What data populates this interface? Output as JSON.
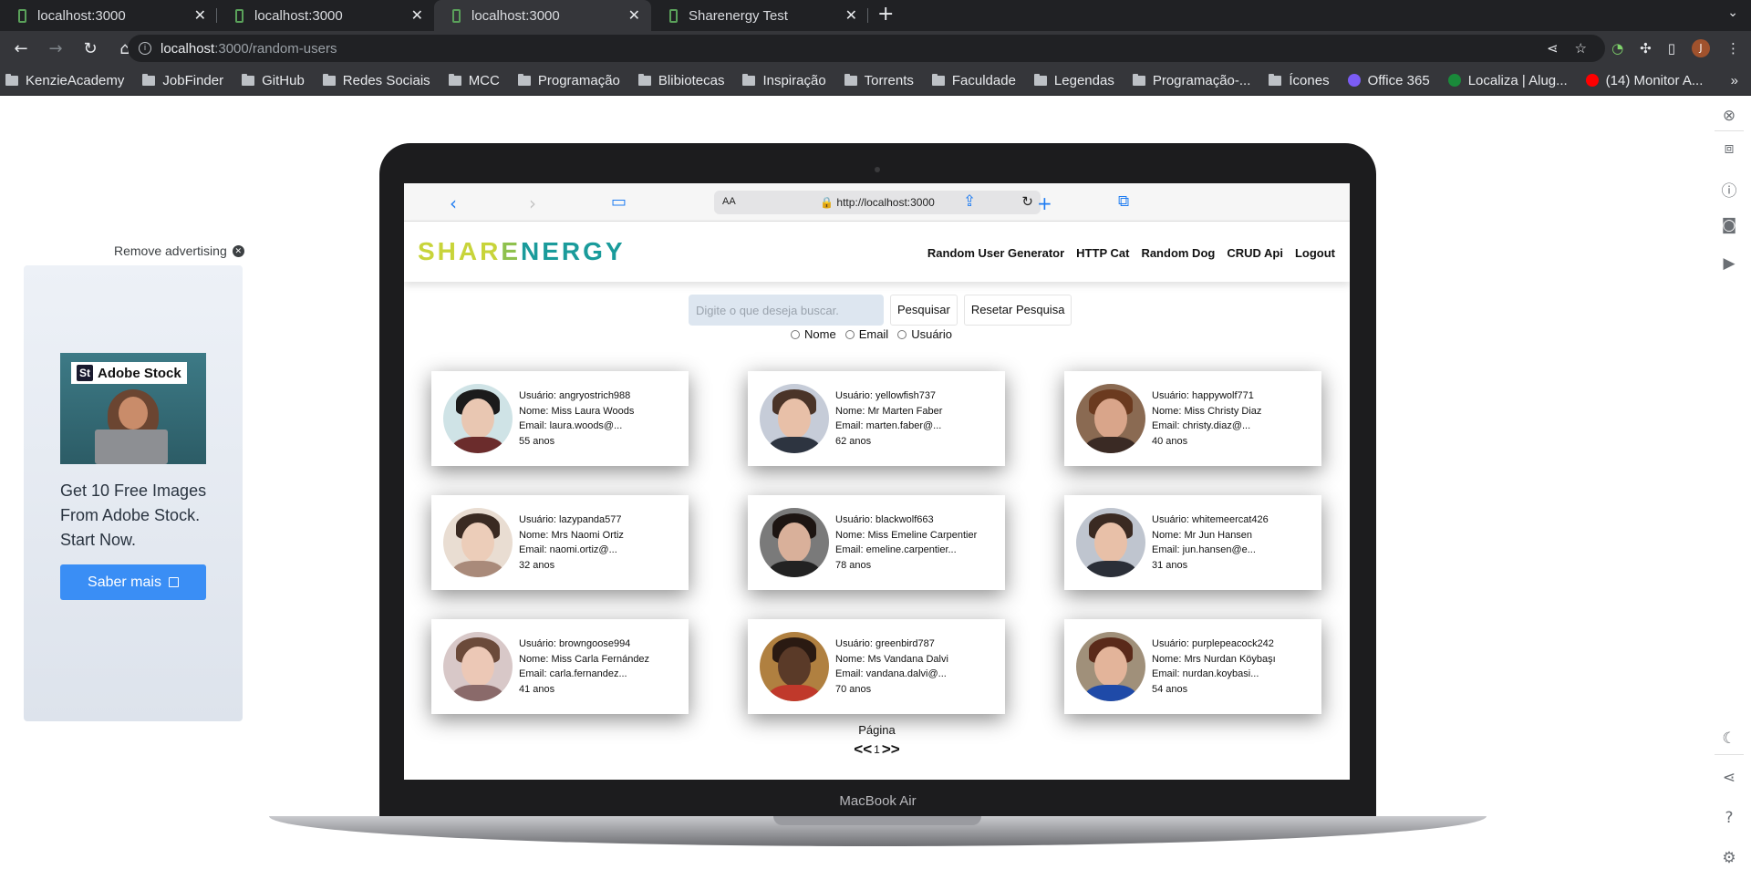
{
  "browser": {
    "tabs": [
      {
        "title": "localhost:3000",
        "active": false
      },
      {
        "title": "localhost:3000",
        "active": false
      },
      {
        "title": "localhost:3000",
        "active": true
      },
      {
        "title": "Sharenergy Test",
        "active": false
      }
    ],
    "address": {
      "host": "localhost",
      "path": ":3000/random-users"
    },
    "profile_initial": "J",
    "bookmarks": [
      {
        "label": "KenzieAcademy",
        "icon": "folder-icon"
      },
      {
        "label": "JobFinder",
        "icon": "folder-icon"
      },
      {
        "label": "GitHub",
        "icon": "folder-icon"
      },
      {
        "label": "Redes Sociais",
        "icon": "folder-icon"
      },
      {
        "label": "MCC",
        "icon": "folder-icon"
      },
      {
        "label": "Programação",
        "icon": "folder-icon"
      },
      {
        "label": "Blibiotecas",
        "icon": "folder-icon"
      },
      {
        "label": "Inspiração",
        "icon": "folder-icon"
      },
      {
        "label": "Torrents",
        "icon": "folder-icon"
      },
      {
        "label": "Faculdade",
        "icon": "folder-icon"
      },
      {
        "label": "Legendas",
        "icon": "folder-icon"
      },
      {
        "label": "Programação-...",
        "icon": "folder-icon"
      },
      {
        "label": "Ícones",
        "icon": "folder-icon"
      },
      {
        "label": "Office 365",
        "icon": "office-icon",
        "color": "#7b5cf5"
      },
      {
        "label": "Localiza | Alug...",
        "icon": "localiza-icon",
        "color": "#1a8a3a"
      },
      {
        "label": "(14) Monitor A...",
        "icon": "youtube-icon",
        "color": "#ff0000"
      }
    ]
  },
  "ad": {
    "remove_label": "Remove advertising",
    "brand": "Adobe Stock",
    "brand_badge": "St",
    "text": "Get 10 Free Images From Adobe Stock. Start Now.",
    "button": "Saber mais"
  },
  "device": {
    "label": "MacBook Air"
  },
  "safari": {
    "text_size": "AA",
    "url": "http://localhost:3000"
  },
  "site": {
    "logo": {
      "part1": "SHAR",
      "part2": "E",
      "part3": "NERGY"
    },
    "nav": [
      "Random User Generator",
      "HTTP Cat",
      "Random Dog",
      "CRUD Api",
      "Logout"
    ],
    "search": {
      "placeholder": "Digite o que deseja buscar.",
      "submit": "Pesquisar",
      "reset": "Resetar Pesquisa"
    },
    "filters": [
      "Nome",
      "Email",
      "Usuário"
    ],
    "users": [
      {
        "username": "Usuário: angryostrich988",
        "name": "Nome: Miss Laura Woods",
        "email": "Email: laura.woods@...",
        "age": "55 anos",
        "skin": "#e9c7b2",
        "hair": "#1b1b1b",
        "shirt": "#6b2c2c",
        "bg": "#cfe3e6"
      },
      {
        "username": "Usuário: yellowfish737",
        "name": "Nome: Mr Marten Faber",
        "email": "Email: marten.faber@...",
        "age": "62 anos",
        "skin": "#e8c0a8",
        "hair": "#4a3428",
        "shirt": "#2d3440",
        "bg": "#c6ccd8"
      },
      {
        "username": "Usuário: happywolf771",
        "name": "Nome: Miss Christy Diaz",
        "email": "Email: christy.diaz@...",
        "age": "40 anos",
        "skin": "#d9a58a",
        "hair": "#6b3a1f",
        "shirt": "#3a2a24",
        "bg": "#8a6a52"
      },
      {
        "username": "Usuário: lazypanda577",
        "name": "Nome: Mrs Naomi Ortiz",
        "email": "Email: naomi.ortiz@...",
        "age": "32 anos",
        "skin": "#eccdb9",
        "hair": "#3a2a22",
        "shirt": "#a98a7a",
        "bg": "#e9ddd2"
      },
      {
        "username": "Usuário: blackwolf663",
        "name": "Nome: Miss Emeline Carpentier",
        "email": "Email: emeline.carpentier...",
        "age": "78 anos",
        "skin": "#d9b09a",
        "hair": "#1d1512",
        "shirt": "#222222",
        "bg": "#7a7a7a"
      },
      {
        "username": "Usuário: whitemeercat426",
        "name": "Nome: Mr Jun Hansen",
        "email": "Email: jun.hansen@e...",
        "age": "31 anos",
        "skin": "#e8c0a8",
        "hair": "#3a2a22",
        "shirt": "#2b2f38",
        "bg": "#bfc5cf"
      },
      {
        "username": "Usuário: browngoose994",
        "name": "Nome: Miss Carla Fernández",
        "email": "Email: carla.fernandez...",
        "age": "41 anos",
        "skin": "#ecc8b6",
        "hair": "#6b4a3a",
        "shirt": "#8a6a6a",
        "bg": "#d8c8c8"
      },
      {
        "username": "Usuário: greenbird787",
        "name": "Nome: Ms Vandana Dalvi",
        "email": "Email: vandana.dalvi@...",
        "age": "70 anos",
        "skin": "#5a3a28",
        "hair": "#2a1a12",
        "shirt": "#c0392b",
        "bg": "#b08040"
      },
      {
        "username": "Usuário: purplepeacock242",
        "name": "Nome: Mrs Nurdan Köybaşı",
        "email": "Email: nurdan.koybasi...",
        "age": "54 anos",
        "skin": "#e3b49a",
        "hair": "#5a2a1a",
        "shirt": "#1f4aa8",
        "bg": "#a0907a"
      }
    ],
    "pagination": {
      "label": "Página",
      "prev": "<<",
      "page": "1",
      "next": ">>"
    }
  }
}
